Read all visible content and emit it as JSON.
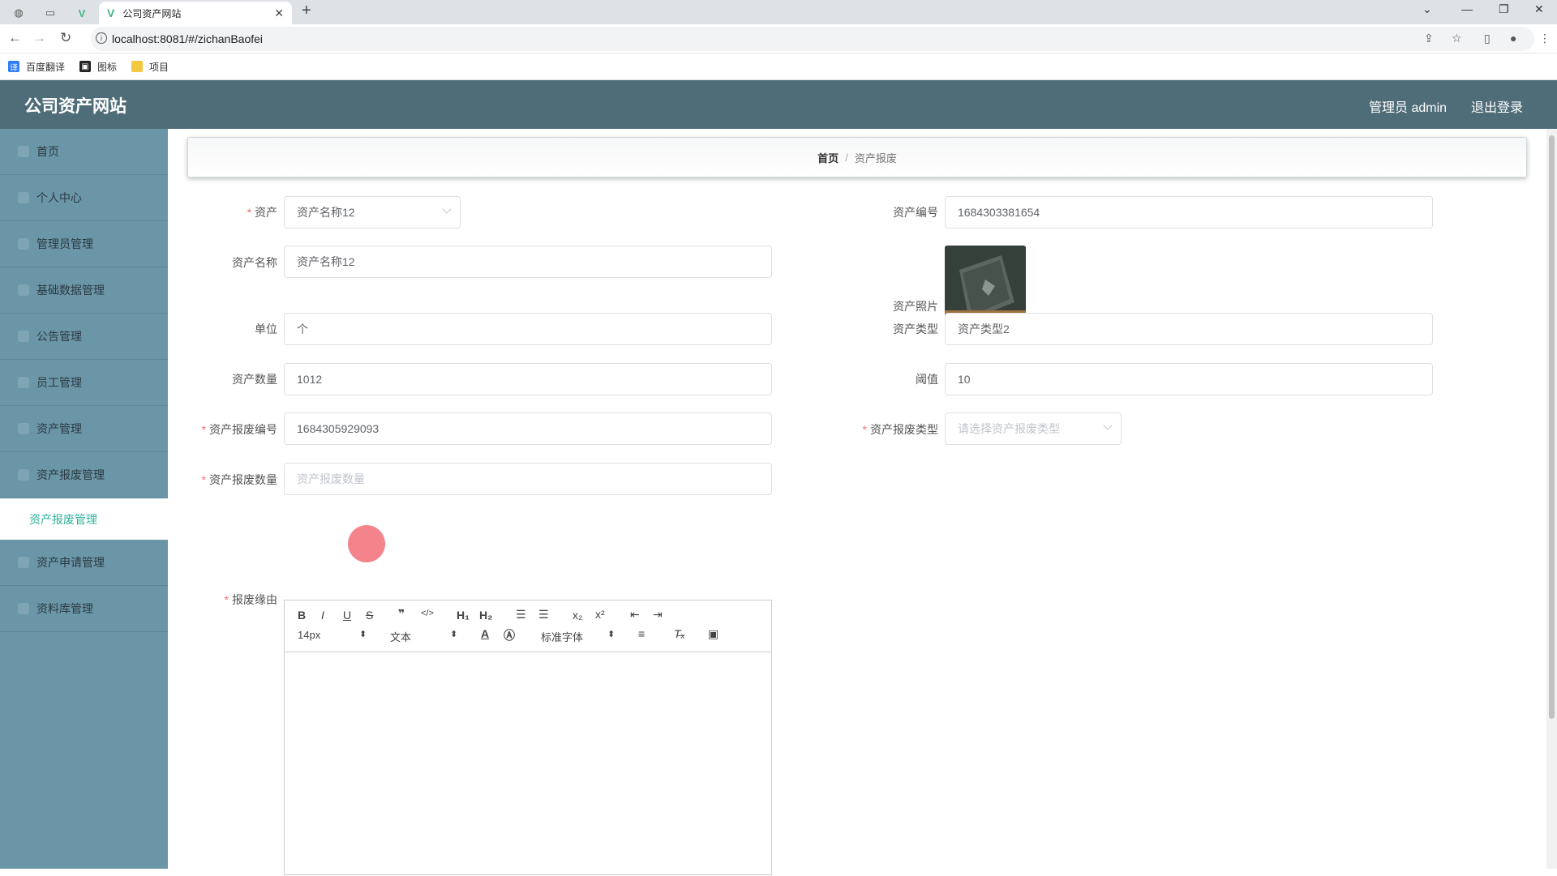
{
  "browser": {
    "tab_title": "公司资产网站",
    "url": "localhost:8081/#/zichanBaofei",
    "bookmarks": [
      "百度翻译",
      "图标",
      "项目"
    ]
  },
  "header": {
    "title": "公司资产网站",
    "user": "管理员 admin",
    "logout": "退出登录"
  },
  "sidebar": {
    "items": [
      {
        "label": "首页"
      },
      {
        "label": "个人中心"
      },
      {
        "label": "管理员管理"
      },
      {
        "label": "基础数据管理"
      },
      {
        "label": "公告管理"
      },
      {
        "label": "员工管理"
      },
      {
        "label": "资产管理"
      },
      {
        "label": "资产报废管理"
      },
      {
        "label": "资产申请管理"
      },
      {
        "label": "资料库管理"
      }
    ],
    "active_sub": "资产报废管理"
  },
  "breadcrumb": {
    "home": "首页",
    "sep": "/",
    "current": "资产报废"
  },
  "form": {
    "asset_label": "资产",
    "asset_value": "资产名称12",
    "asset_no_label": "资产编号",
    "asset_no_value": "1684303381654",
    "asset_name_label": "资产名称",
    "asset_name_value": "资产名称12",
    "photo_label": "资产照片",
    "unit_label": "单位",
    "unit_value": "个",
    "type_label": "资产类型",
    "type_value": "资产类型2",
    "qty_label": "资产数量",
    "qty_value": "1012",
    "threshold_label": "阈值",
    "threshold_value": "10",
    "scrap_no_label": "资产报废编号",
    "scrap_no_value": "1684305929093",
    "scrap_type_label": "资产报废类型",
    "scrap_type_placeholder": "请选择资产报废类型",
    "scrap_qty_label": "资产报废数量",
    "scrap_qty_placeholder": "资产报废数量",
    "reason_label": "报废缘由"
  },
  "editor": {
    "font_size": "14px",
    "text_style": "文本",
    "font_family": "标准字体"
  }
}
